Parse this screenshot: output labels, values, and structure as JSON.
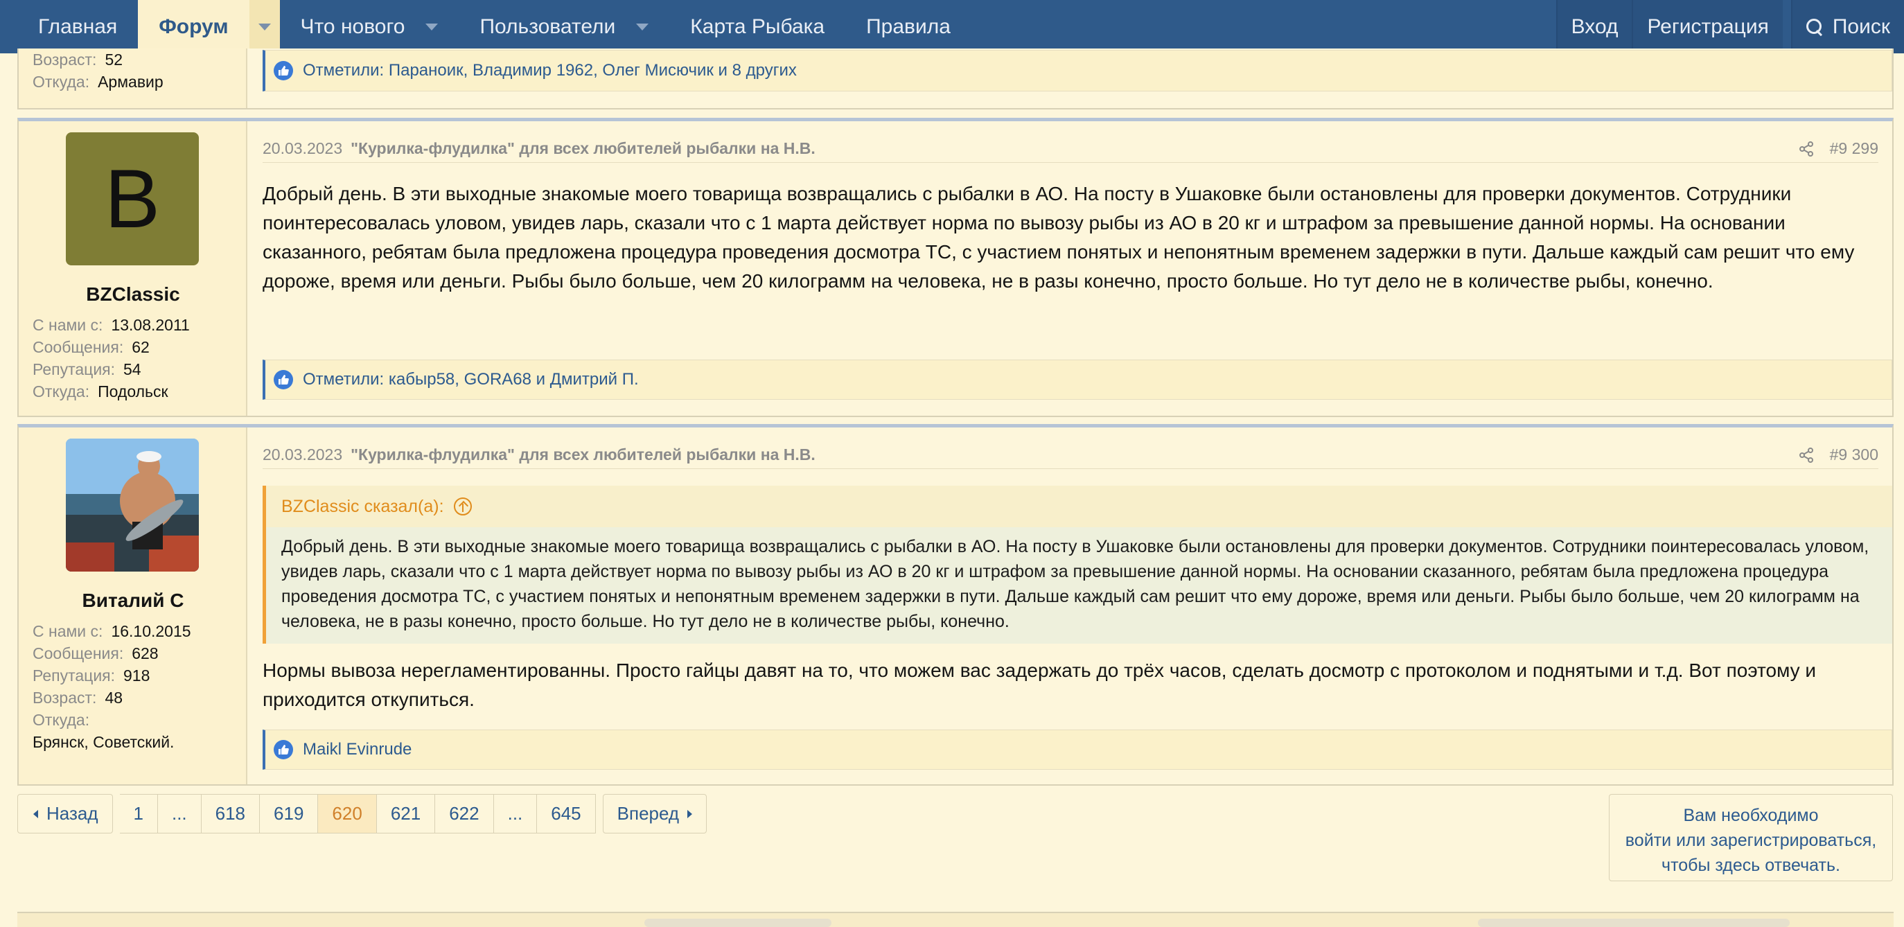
{
  "nav": {
    "home": "Главная",
    "forum": "Форум",
    "whats_new": "Что нового",
    "users": "Пользователи",
    "map": "Карта Рыбака",
    "rules": "Правила",
    "login": "Вход",
    "register": "Регистрация",
    "search": "Поиск"
  },
  "prev_post": {
    "age_label": "Возраст:",
    "age": "52",
    "from_label": "Откуда:",
    "from": "Армавир",
    "reactions_prefix": "Отметили:",
    "reactions_names": "Параноик, Владимир 1962, Олег Мисючик и 8 других"
  },
  "post1": {
    "avatar_letter": "B",
    "username": "BZClassic",
    "joined_label": "С нами с:",
    "joined": "13.08.2011",
    "messages_label": "Сообщения:",
    "messages": "62",
    "rep_label": "Репутация:",
    "rep": "54",
    "from_label": "Откуда:",
    "from": "Подольск",
    "date": "20.03.2023",
    "thread": "\"Курилка-флудилка\" для всех любителей рыбалки на Н.В.",
    "number": "#9 299",
    "text": "Добрый день. В эти выходные знакомые моего товарища возвращались с рыбалки в АО. На посту в Ушаковке были остановлены для проверки документов. Сотрудники поинтересовалась уловом, увидев ларь, сказали что с 1 марта действует норма по вывозу рыбы из АО в 20 кг и штрафом за превышение данной нормы. На основании сказанного, ребятам была предложена процедура проведения досмотра ТС, с участием понятых и непонятным временем задержки в пути. Дальше каждый сам решит что ему дороже, время или деньги. Рыбы было больше, чем 20 килограмм на человека, не в разы конечно, просто больше. Но тут дело не в количестве рыбы, конечно.",
    "reactions_prefix": "Отметили:",
    "reactions_names": "кабыр58, GORA68 и Дмитрий П."
  },
  "post2": {
    "username": "Виталий С",
    "joined_label": "С нами с:",
    "joined": "16.10.2015",
    "messages_label": "Сообщения:",
    "messages": "628",
    "rep_label": "Репутация:",
    "rep": "918",
    "age_label": "Возраст:",
    "age": "48",
    "from_label": "Откуда:",
    "from": "Брянск, Советский.",
    "date": "20.03.2023",
    "thread": "\"Курилка-флудилка\" для всех любителей рыбалки на Н.В.",
    "number": "#9 300",
    "quote_author": "BZClassic сказал(а):",
    "quote_text": "Добрый день. В эти выходные знакомые моего товарища возвращались с рыбалки в АО. На посту в Ушаковке были остановлены для проверки документов. Сотрудники поинтересовалась уловом, увидев ларь, сказали что с 1 марта действует норма по вывозу рыбы из АО в 20 кг и штрафом за превышение данной нормы. На основании сказанного, ребятам была предложена процедура проведения досмотра ТС, с участием понятых и непонятным временем задержки в пути. Дальше каждый сам решит что ему дороже, время или деньги. Рыбы было больше, чем 20 килограмм на человека, не в разы конечно, просто больше. Но тут дело не в количестве рыбы, конечно.",
    "text": "Нормы вывоза нерегламентированны. Просто гайцы давят на то, что можем вас задержать до трёх часов, сделать досмотр с протоколом и поднятыми и т.д. Вот поэтому и приходится откупиться.",
    "reactions_names": "Maikl Evinrude"
  },
  "pagination": {
    "prev": "Назад",
    "pages": [
      "1",
      "...",
      "618",
      "619",
      "620",
      "621",
      "622",
      "...",
      "645"
    ],
    "current": "620",
    "next": "Вперед"
  },
  "login_prompt": {
    "line1": "Вам необходимо",
    "line2": "войти или зарегистрироваться,",
    "line3": "чтобы здесь отвечать."
  },
  "colors": {
    "nav_bg": "#2f5a8a",
    "page_bg": "#fdf6db",
    "link": "#2c5a8f",
    "quote_accent": "#f0a138",
    "avatar_bg": "#7f7d35"
  }
}
